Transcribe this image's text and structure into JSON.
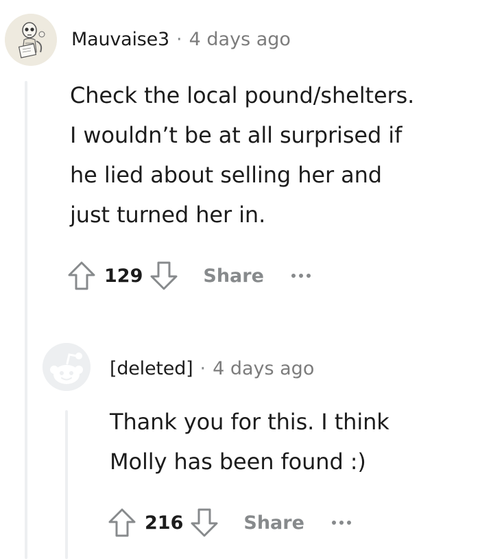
{
  "comments": [
    {
      "author": "Mauvaise3",
      "separator": "·",
      "time": "4 days ago",
      "lines": [
        "Check the local pound/shelters.",
        "I wouldn’t be at all surprised if",
        "he lied about selling her and",
        "just turned her in."
      ],
      "score": "129",
      "share_label": "Share",
      "avatar_icon": "skeleton-reading-avatar"
    },
    {
      "author": "[deleted]",
      "separator": "·",
      "time": "4 days ago",
      "lines": [
        "Thank you for this. I think",
        "Molly has been found :)"
      ],
      "score": "216",
      "share_label": "Share",
      "avatar_icon": "default-snoo-avatar"
    }
  ],
  "colors": {
    "text": "#1c1c1c",
    "muted": "#878a8c",
    "thread_line": "#edeff1"
  }
}
